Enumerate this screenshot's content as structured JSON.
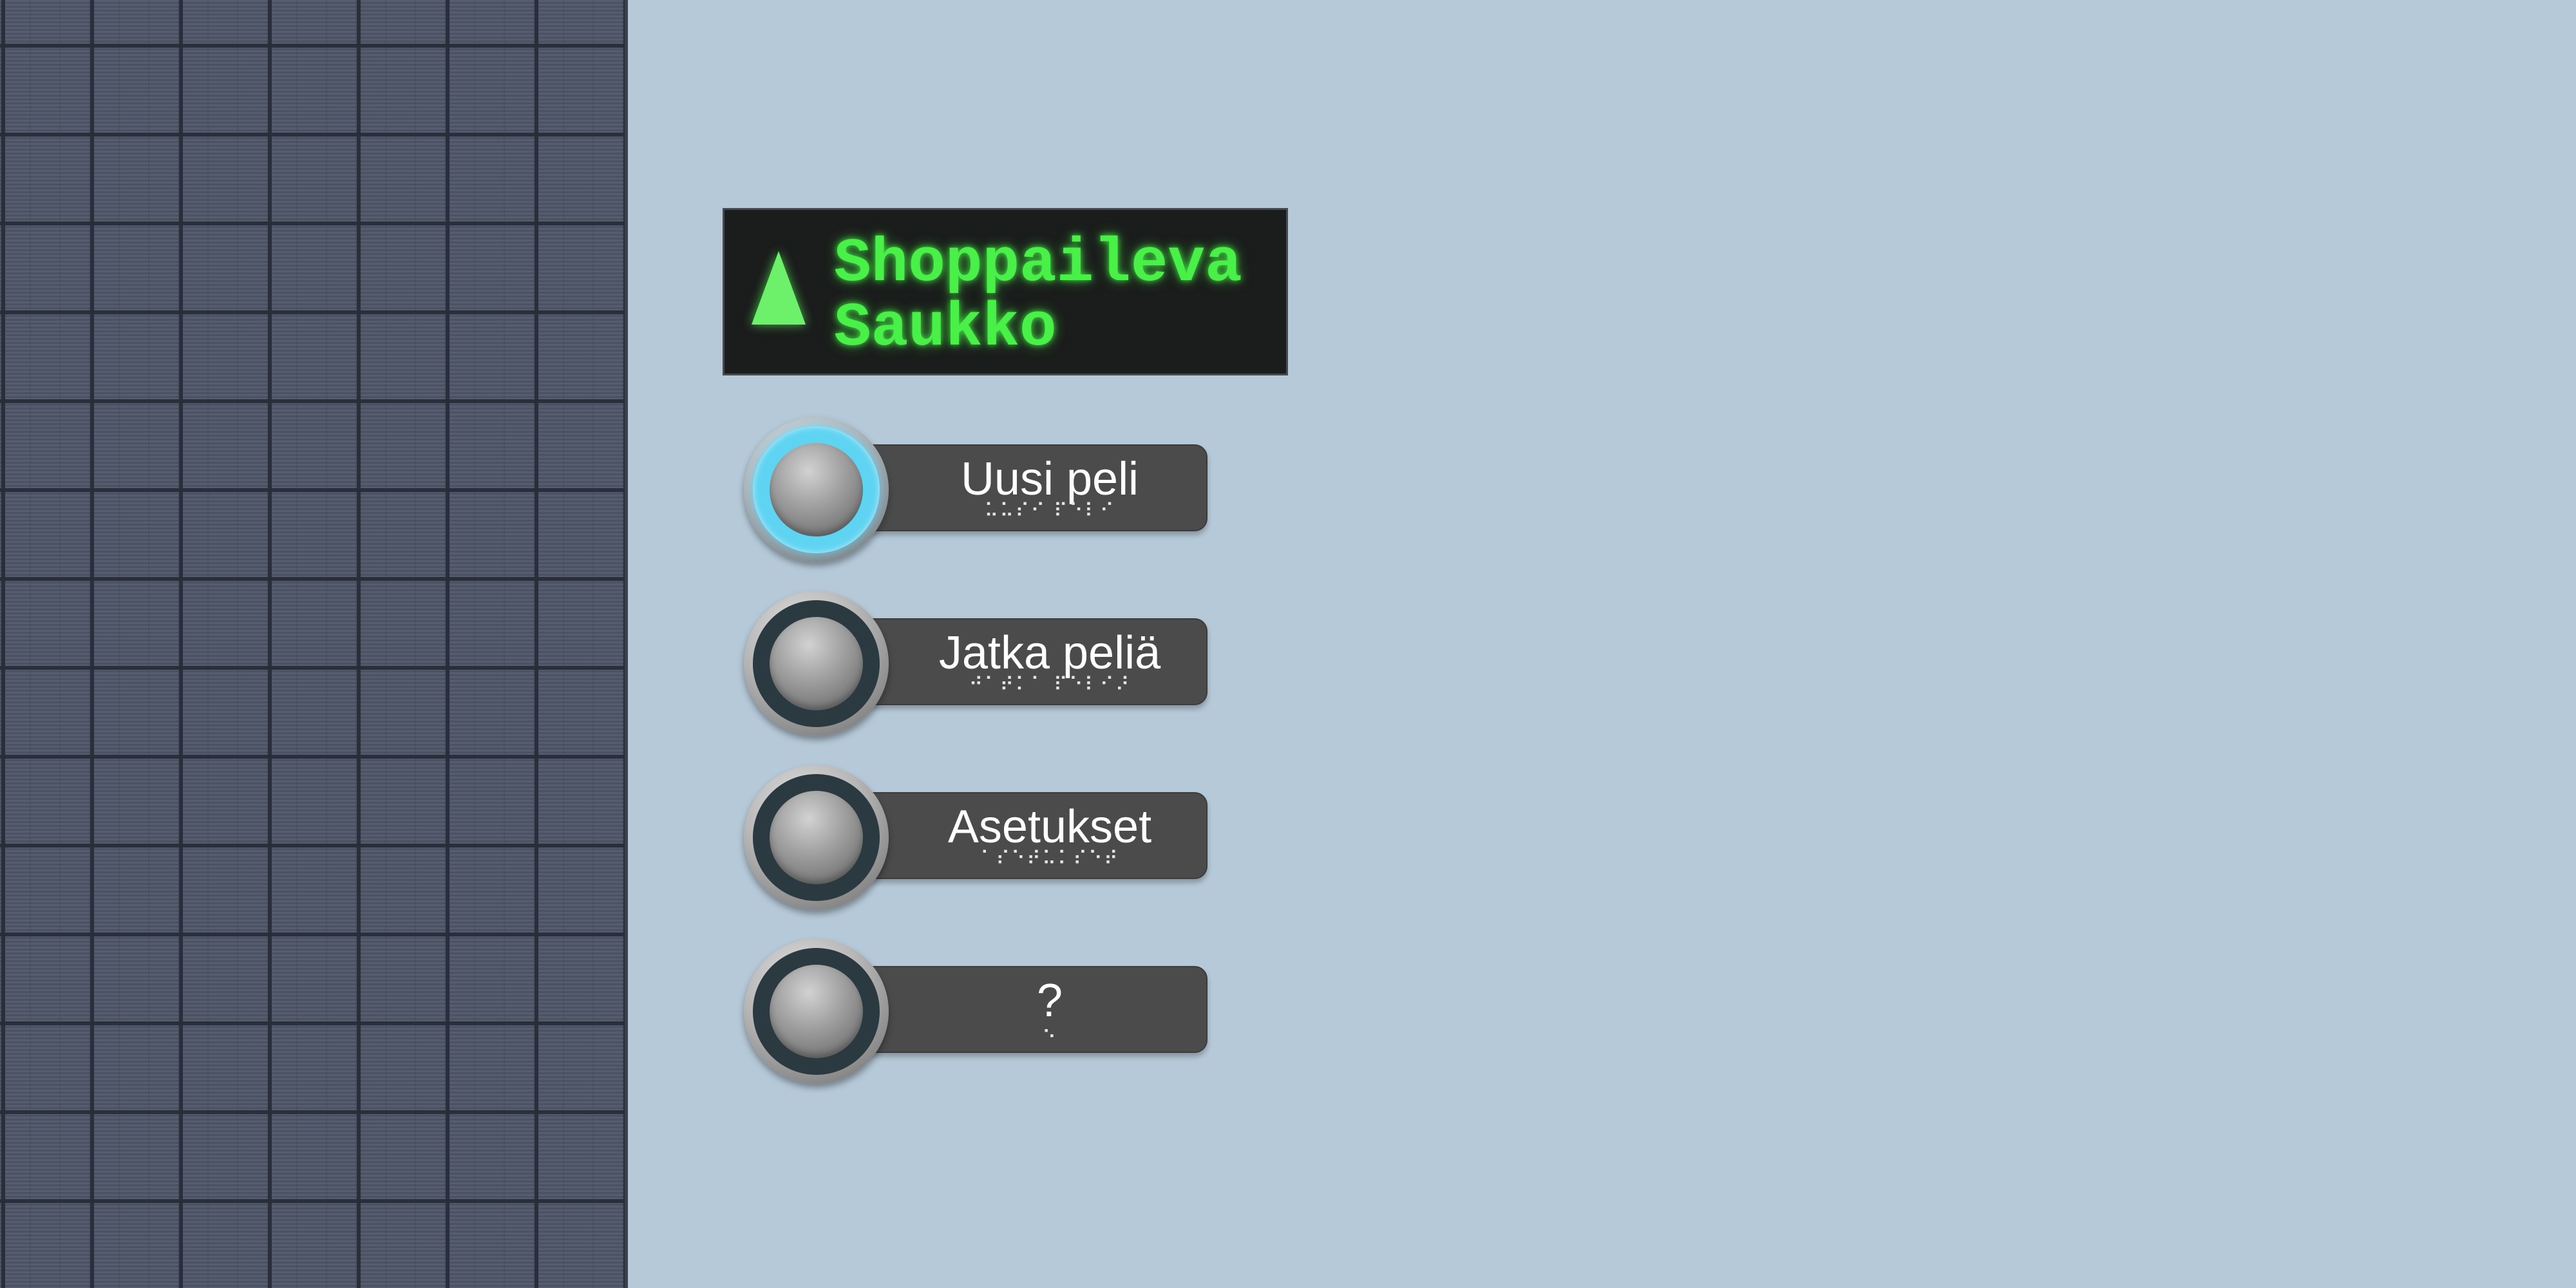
{
  "title": {
    "text": "Shoppaileva\nSaukko",
    "color": "#49f048",
    "icon": "triangle-up-icon"
  },
  "menu": {
    "items": [
      {
        "label": "Uusi peli",
        "braille": "⠥⠥⠎⠊ ⠏⠑⠇⠊",
        "selected": true
      },
      {
        "label": "Jatka peliä",
        "braille": "⠚⠁⠞⠅⠁ ⠏⠑⠇⠊⠜",
        "selected": false
      },
      {
        "label": "Asetukset",
        "braille": "⠁⠎⠑⠞⠥⠅⠎⠑⠞",
        "selected": false
      },
      {
        "label": "?",
        "braille": "⠢",
        "selected": false
      }
    ],
    "accent_color": "#5fd4f2"
  },
  "colors": {
    "background": "#b6c9d8",
    "grid_panel": "#4e5668",
    "label_bar": "#4b4b4b"
  }
}
